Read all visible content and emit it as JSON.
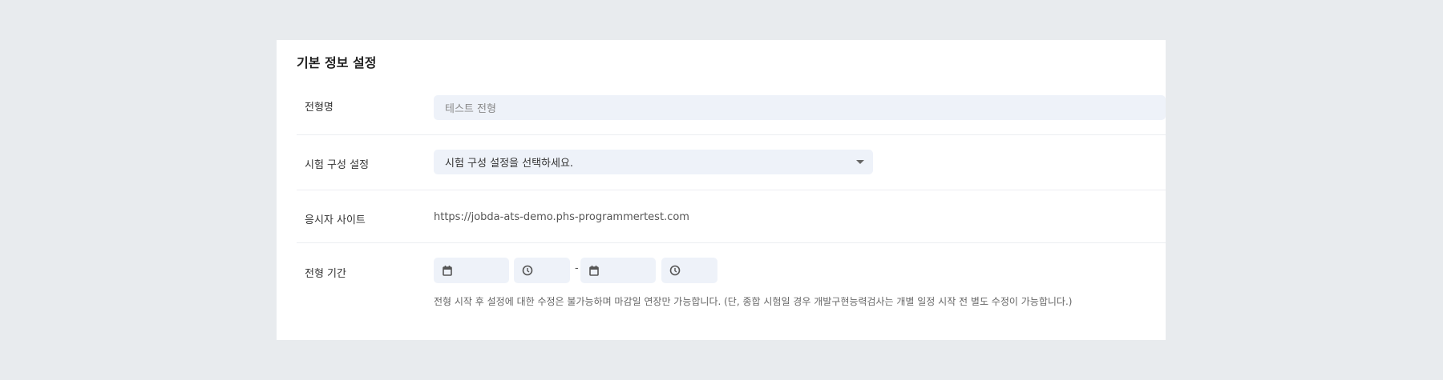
{
  "section_title": "기본 정보 설정",
  "rows": {
    "name": {
      "label": "전형명",
      "value": "테스트 전형"
    },
    "exam_config": {
      "label": "시험 구성 설정",
      "placeholder": "시험 구성 설정을 선택하세요."
    },
    "site": {
      "label": "응시자 사이트",
      "url": "https://jobda-ats-demo.phs-programmertest.com"
    },
    "period": {
      "label": "전형 기간",
      "separator": "-",
      "help": "전형 시작 후 설정에 대한 수정은 불가능하며 마감일 연장만 가능합니다. (단, 종합 시험일 경우 개발구현능력검사는 개별 일정 시작 전 별도 수정이 가능합니다.)"
    }
  }
}
